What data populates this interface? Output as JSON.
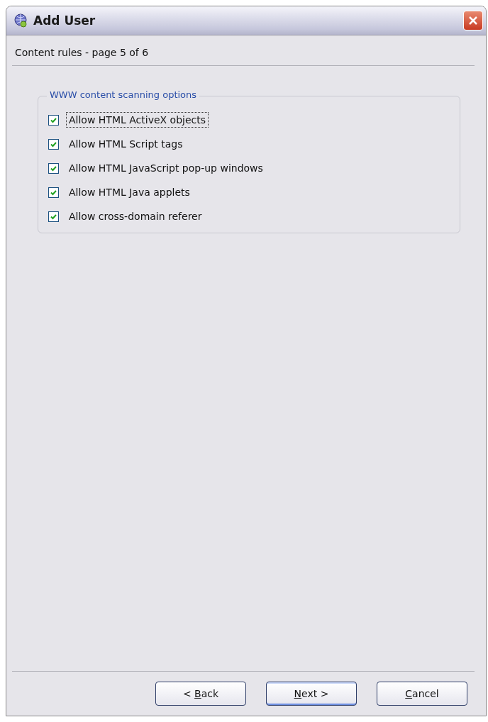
{
  "window": {
    "title": "Add User"
  },
  "subtitle": "Content rules - page 5 of 6",
  "group": {
    "title": "WWW content scanning options",
    "options": [
      {
        "label": "Allow HTML ActiveX objects",
        "checked": true,
        "focused": true
      },
      {
        "label": "Allow HTML Script tags",
        "checked": true,
        "focused": false
      },
      {
        "label": "Allow HTML JavaScript pop-up windows",
        "checked": true,
        "focused": false
      },
      {
        "label": "Allow HTML Java applets",
        "checked": true,
        "focused": false
      },
      {
        "label": "Allow cross-domain referer",
        "checked": true,
        "focused": false
      }
    ]
  },
  "buttons": [
    {
      "before": "< ",
      "access_key": "B",
      "after": "ack",
      "default": false
    },
    {
      "access_key": "N",
      "after": "ext >",
      "default": true
    },
    {
      "access_key": "C",
      "after": "ancel",
      "default": false
    }
  ]
}
